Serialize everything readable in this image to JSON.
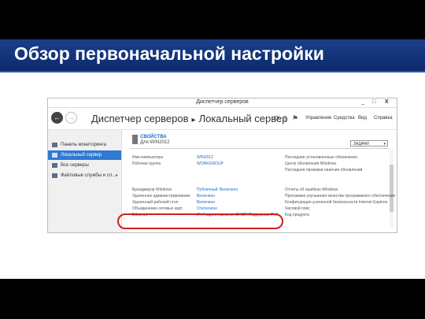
{
  "slide": {
    "title": "Обзор первоначальной настройки"
  },
  "window": {
    "title": "Диспетчер серверов",
    "minimize": "_",
    "maximize": "□",
    "close": "X"
  },
  "nav": {
    "back": "←",
    "forward": "→",
    "breadcrumb_root": "Диспетчер серверов",
    "breadcrumb_sep": "▸",
    "breadcrumb_current": "Локальный сервер",
    "refresh_icon": "⟳",
    "flag_icon": "⚑",
    "menu": [
      "Управление",
      "Средства",
      "Вид",
      "Справка"
    ]
  },
  "sidebar": {
    "items": [
      {
        "label": "Панель мониторинга",
        "icon": "dashboard-icon"
      },
      {
        "label": "Локальный сервер",
        "icon": "server-icon"
      },
      {
        "label": "Все серверы",
        "icon": "servers-icon"
      },
      {
        "label": "Файловые службы и сл...",
        "icon": "file-services-icon"
      }
    ],
    "expand_arrow": "▸"
  },
  "properties": {
    "heading": "СВОЙСТВА",
    "subheading": "Для WIN2012",
    "tasks": "ЗАДАЧИ",
    "tasks_caret": "▾",
    "left": [
      {
        "label": "Имя компьютера",
        "value": "WIN2012"
      },
      {
        "label": "Рабочая группа",
        "value": "WORKGROUP"
      },
      {
        "label": "Брандмауэр Windows",
        "value": "Публичный: Включено"
      },
      {
        "label": "Удаленное администрирование",
        "value": "Включено"
      },
      {
        "label": "Удаленный рабочий стол",
        "value": "Включено"
      },
      {
        "label": "Объединение сетевых карт",
        "value": "Отключено"
      },
      {
        "label": "Ethernet",
        "value": "IPv4-адрес назначен DHCP, Поддержка IPv6"
      }
    ],
    "right": [
      "Последние установленные обновления",
      "Центр обновления Windows",
      "Последняя проверка наличия обновлений",
      "Отчеты об ошибках Windows",
      "Программа улучшения качества программного обеспечения",
      "Конфигурация усиленной безопасности Internet Explorer",
      "Часовой пояс",
      "Код продукта"
    ]
  },
  "colors": {
    "title_band": "#1a3f8a",
    "accent": "#2f79d2",
    "highlight": "#d21e1e",
    "link": "#1c6fc4"
  }
}
